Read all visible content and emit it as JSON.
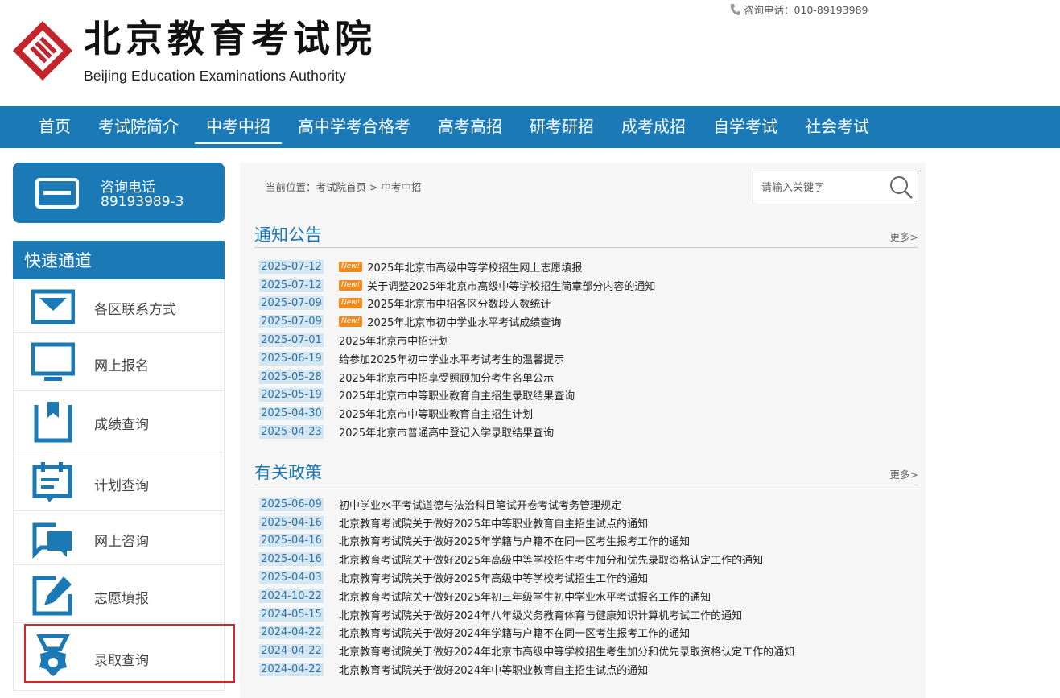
{
  "header": {
    "logo_cn": "北京教育考试院",
    "logo_en": "Beijing Education Examinations Authority",
    "hotline": "咨询电话：010-89193989"
  },
  "nav": {
    "items": [
      {
        "label": "首页",
        "active": false
      },
      {
        "label": "考试院简介",
        "active": false
      },
      {
        "label": "中考中招",
        "active": true
      },
      {
        "label": "高中学考合格考",
        "active": false
      },
      {
        "label": "高考高招",
        "active": false
      },
      {
        "label": "研考研招",
        "active": false
      },
      {
        "label": "成考成招",
        "active": false
      },
      {
        "label": "自学考试",
        "active": false
      },
      {
        "label": "社会考试",
        "active": false
      }
    ]
  },
  "consult": {
    "title": "咨询电话",
    "number": "89193989-3"
  },
  "quick": {
    "heading": "快速通道",
    "items": [
      {
        "label": "各区联系方式",
        "icon": "envelope-icon"
      },
      {
        "label": "网上报名",
        "icon": "monitor-icon"
      },
      {
        "label": "成绩查询",
        "icon": "bookmark-icon"
      },
      {
        "label": "计划查询",
        "icon": "calendar-icon"
      },
      {
        "label": "网上咨询",
        "icon": "chat-icon"
      },
      {
        "label": "志愿填报",
        "icon": "edit-icon"
      },
      {
        "label": "录取查询",
        "icon": "medal-icon"
      }
    ]
  },
  "main": {
    "breadcrumb": "当前位置：考试院首页 > 中考中招",
    "search_placeholder": "请输入关键字",
    "notice": {
      "title": "通知公告",
      "more": "更多>",
      "new_badge": "New!",
      "items": [
        {
          "date": "2025-07-12",
          "title": "2025年北京市高级中等学校招生网上志愿填报",
          "is_new": true
        },
        {
          "date": "2025-07-12",
          "title": "关于调整2025年北京市高级中等学校招生简章部分内容的通知",
          "is_new": true
        },
        {
          "date": "2025-07-09",
          "title": "2025年北京市中招各区分数段人数统计",
          "is_new": true
        },
        {
          "date": "2025-07-09",
          "title": "2025年北京市初中学业水平考试成绩查询",
          "is_new": true
        },
        {
          "date": "2025-07-01",
          "title": "2025年北京市中招计划",
          "is_new": false
        },
        {
          "date": "2025-06-19",
          "title": "给参加2025年初中学业水平考试考生的温馨提示",
          "is_new": false
        },
        {
          "date": "2025-05-28",
          "title": "2025年北京市中招享受照顾加分考生名单公示",
          "is_new": false
        },
        {
          "date": "2025-05-19",
          "title": "2025年北京市中等职业教育自主招生录取结果查询",
          "is_new": false
        },
        {
          "date": "2025-04-30",
          "title": "2025年北京市中等职业教育自主招生计划",
          "is_new": false
        },
        {
          "date": "2025-04-23",
          "title": "2025年北京市普通高中登记入学录取结果查询",
          "is_new": false
        }
      ]
    },
    "policy": {
      "title": "有关政策",
      "more": "更多>",
      "items": [
        {
          "date": "2025-06-09",
          "title": "初中学业水平考试道德与法治科目笔试开卷考试考务管理规定"
        },
        {
          "date": "2025-04-16",
          "title": "北京教育考试院关于做好2025年中等职业教育自主招生试点的通知"
        },
        {
          "date": "2025-04-16",
          "title": "北京教育考试院关于做好2025年学籍与户籍不在同一区考生报考工作的通知"
        },
        {
          "date": "2025-04-16",
          "title": "北京教育考试院关于做好2025年高级中等学校招生考生加分和优先录取资格认定工作的通知"
        },
        {
          "date": "2025-04-03",
          "title": "北京教育考试院关于做好2025年高级中等学校考试招生工作的通知"
        },
        {
          "date": "2024-10-22",
          "title": "北京教育考试院关于做好2025年初三年级学生初中学业水平考试报名工作的通知"
        },
        {
          "date": "2024-05-15",
          "title": "北京教育考试院关于做好2024年八年级义务教育体育与健康知识计算机考试工作的通知"
        },
        {
          "date": "2024-04-22",
          "title": "北京教育考试院关于做好2024年学籍与户籍不在同一区考生报考工作的通知"
        },
        {
          "date": "2024-04-22",
          "title": "北京教育考试院关于做好2024年北京市高级中等学校招生考生加分和优先录取资格认定工作的通知"
        },
        {
          "date": "2024-04-22",
          "title": "北京教育考试院关于做好2024年中等职业教育自主招生试点的通知"
        }
      ]
    }
  },
  "colors": {
    "brand_blue": "#1b7ab6",
    "logo_red": "#c4242b",
    "new_badge": "#f08a1c",
    "highlight_red": "#d9252a"
  }
}
